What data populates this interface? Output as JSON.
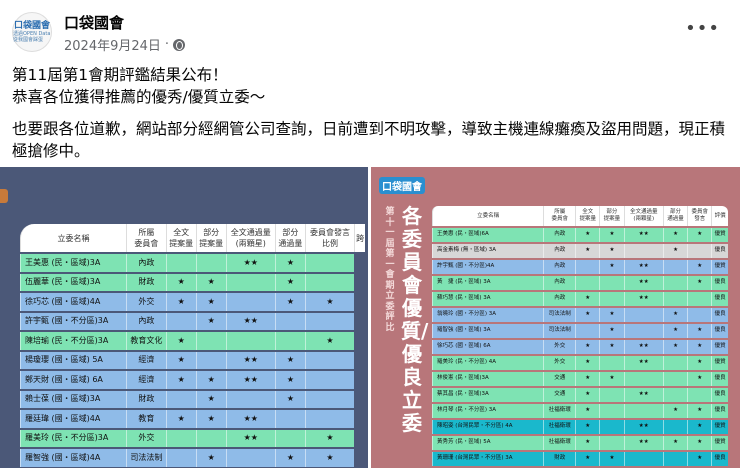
{
  "post": {
    "author": "口袋國會",
    "date": "2024年9月24日",
    "avatar_text": "口袋國會",
    "avatar_sub": "透過OPEN Data 從我國會踩蛋",
    "more": "•••",
    "lines": [
      "第11屆第1會期評鑑結果公布！",
      "恭喜各位獲得推薦的優秀/優質立委～",
      "也要跟各位道歉，網站部分經網管公司查詢，日前遭到不明攻擊，導致主機連線癱瘓及盜用問題，現正積極搶修中。"
    ]
  },
  "left": {
    "headers": [
      "立委名稱",
      "所屬\n委員會",
      "全文\n提案量",
      "部分\n提案量",
      "全文通過量\n(兩顆星)",
      "部分\n通過量",
      "委員會發言\n比例",
      "跨"
    ],
    "rows": [
      [
        "g",
        "王美惠 (民・區域)3A",
        "內政",
        "",
        "",
        "★★",
        "★",
        ""
      ],
      [
        "g",
        "伍麗華 (民・區域)3A",
        "財政",
        "★",
        "★",
        "",
        "★",
        ""
      ],
      [
        "b",
        "徐巧芯 (國・區域)4A",
        "外交",
        "★",
        "★",
        "",
        "★",
        "★"
      ],
      [
        "b",
        "許宇甄 (國・不分區)3A",
        "內政",
        "",
        "★",
        "★★",
        "",
        ""
      ],
      [
        "g",
        "陳培瑜 (民・不分區)3A",
        "教育文化",
        "★",
        "",
        "",
        "",
        "★"
      ],
      [
        "b",
        "楊瓊瓔 (國・區域) 5A",
        "經濟",
        "★",
        "",
        "★★",
        "★",
        ""
      ],
      [
        "b",
        "鄭天財 (國・區域) 6A",
        "經濟",
        "★",
        "★",
        "★★",
        "★",
        ""
      ],
      [
        "b",
        "賴士葆 (國・區域)3A",
        "財政",
        "",
        "★",
        "",
        "★",
        ""
      ],
      [
        "b",
        "羅廷瑋 (國・區域)4A",
        "教育",
        "★",
        "★",
        "★★",
        "",
        ""
      ],
      [
        "g",
        "羅美玲 (民・不分區)3A",
        "外交",
        "",
        "",
        "★★",
        "",
        "★"
      ],
      [
        "b",
        "羅智強 (國・區域)4A",
        "司法法制",
        "",
        "★",
        "",
        "★",
        "★"
      ]
    ]
  },
  "right": {
    "logo": "口袋國會",
    "subtitle": "第十一屆第一會期 立委評比",
    "title": "各委員會優質/優良立委",
    "headers": [
      "立委名稱",
      "所屬\n委員會",
      "全文\n提案量",
      "部分\n提案量",
      "全文通過量\n(兩顆星)",
      "部分\n通過量",
      "委員會\n發言",
      "評價"
    ],
    "rows": [
      [
        "g",
        "王美惠 (民・區域)6A",
        "內政",
        "★",
        "★",
        "★★",
        "★",
        "★",
        "優質"
      ],
      [
        "gr",
        "高金素梅 (無・區域) 3A",
        "內政",
        "★",
        "★",
        "",
        "★",
        "",
        "優良"
      ],
      [
        "b",
        "許宇甄 (國・不分區)4A",
        "內政",
        "",
        "★",
        "★★",
        "",
        "★",
        "優質"
      ],
      [
        "g",
        "黃　捷 (民・區域) 3A",
        "內政",
        "",
        "",
        "★★",
        "",
        "★",
        "優良"
      ],
      [
        "g",
        "蘇巧慧 (民・區域) 3A",
        "內政",
        "★",
        "",
        "★★",
        "",
        "",
        "優良"
      ],
      [
        "b",
        "翁曉玲 (國・不分區) 3A",
        "司法法制",
        "★",
        "★",
        "",
        "★",
        "",
        "優良"
      ],
      [
        "b",
        "羅智強 (國・區域) 3A",
        "司法法制",
        "",
        "★",
        "",
        "★",
        "★",
        "優良"
      ],
      [
        "b",
        "徐巧芯 (國・區域) 6A",
        "外交",
        "★",
        "★",
        "★★",
        "★",
        "★",
        "優質"
      ],
      [
        "g",
        "羅美玲 (民・不分區) 4A",
        "外交",
        "★",
        "",
        "★★",
        "",
        "★",
        "優質"
      ],
      [
        "g",
        "林俊憲 (民・區域)3A",
        "交通",
        "★",
        "★",
        "",
        "",
        "★",
        "優良"
      ],
      [
        "g",
        "蔡其昌 (民・區域)3A",
        "交通",
        "★",
        "",
        "★★",
        "",
        "",
        "優良"
      ],
      [
        "g",
        "林月琴 (民・不分區) 3A",
        "社福衛環",
        "★",
        "",
        "",
        "★",
        "★",
        "優良"
      ],
      [
        "t",
        "陳昭姿 (台灣民眾・不分區) 4A",
        "社福衛環",
        "★",
        "",
        "★★",
        "",
        "★",
        "優質"
      ],
      [
        "g",
        "黃秀芳 (民・區域) 5A",
        "社福衛環",
        "★",
        "",
        "★★",
        "★",
        "★",
        "優質"
      ],
      [
        "t",
        "黃珊珊 (台灣民眾・不分區) 3A",
        "財政",
        "★",
        "★",
        "",
        "",
        "★",
        "優良"
      ]
    ]
  }
}
